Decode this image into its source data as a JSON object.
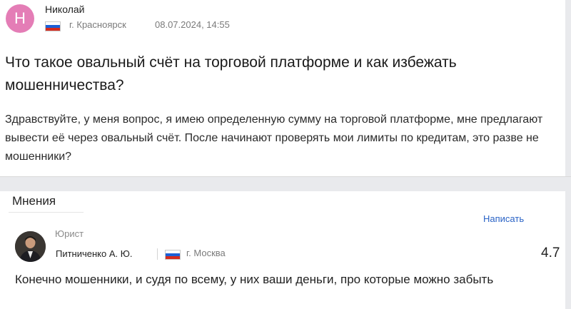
{
  "question": {
    "avatar_letter": "Н",
    "author": "Николай",
    "city": "г. Красноярск",
    "date": "08.07.2024, 14:55",
    "title": "Что такое овальный счёт на торговой платформе и как избежать мошенничества?",
    "body": "Здравствуйте, у меня вопрос, я имею определенную сумму на торговой платформе, мне предлагают вывести её через овальный счёт. После начинают проверять мои лимиты по кредитам, это разве не мошенники?"
  },
  "opinions": {
    "tab_label": "Мнения",
    "write_label": "Написать"
  },
  "answer": {
    "role": "Юрист",
    "name": "Питниченко А. Ю.",
    "city": "г. Москва",
    "rating": "4.7",
    "text": "Конечно мошенники, и судя по всему, у них ваши деньги, про которые можно забыть"
  },
  "colors": {
    "avatar_pink": "#e47db6",
    "link_blue": "#2a63c6",
    "background": "#e9eaed"
  }
}
